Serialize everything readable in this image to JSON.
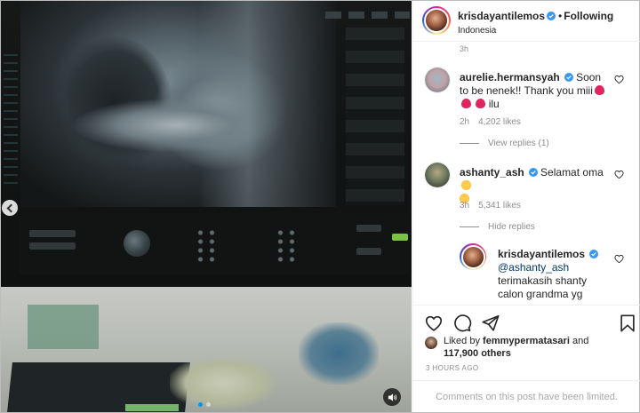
{
  "post": {
    "author": "krisdayantilemos",
    "separator": "•",
    "follow_status": "Following",
    "location": "Indonesia"
  },
  "comments": [
    {
      "username": "aurelie.hermansyah",
      "text": "Soon to be nenek!! Thank you miii",
      "text_suffix": "ilu",
      "time": "2h",
      "likes": "4,202 likes",
      "replies_toggle": "View replies (1)"
    },
    {
      "username": "ashanty_ash",
      "text": "Selamat oma",
      "time": "3h",
      "likes": "5,341 likes",
      "replies_toggle": "Hide replies"
    }
  ],
  "reply": {
    "username": "krisdayantilemos",
    "mention": "@ashanty_ash",
    "text": "terimakasih shanty calon grandma yg"
  },
  "previous_comment_time": "3h",
  "liked_by": {
    "prefix": "Liked by",
    "user": "femmypermatasari",
    "joiner": "and",
    "count": "117,900 others"
  },
  "timestamp": "3 HOURS AGO",
  "comments_limited": "Comments on this post have been limited.",
  "icons": [
    "verified-badge",
    "heart-icon",
    "comment-icon",
    "share-icon",
    "save-icon",
    "speaker-icon",
    "chevron-left-icon"
  ],
  "colors": {
    "accent_blue": "#0095f6",
    "verified_blue": "#3897f0",
    "muted_text": "#8e8e8e"
  },
  "carousel": {
    "count": 2,
    "active_index": 1
  }
}
